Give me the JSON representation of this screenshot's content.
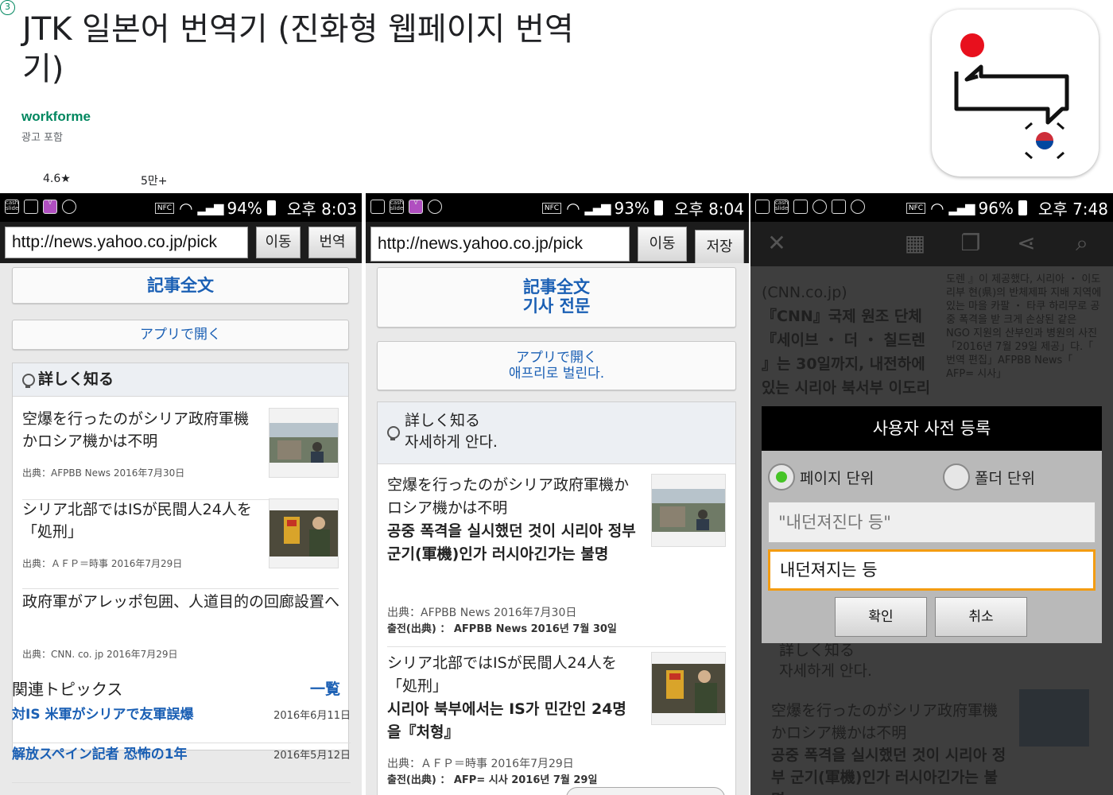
{
  "header": {
    "title": "JTK 일본어 번역기 (진화형 웹페이지 번역기)",
    "developer": "workforme",
    "ads": "광고 포함",
    "rating": "4.6★",
    "downloads": "5만+",
    "age": "3"
  },
  "colors": {
    "link_blue": "#1a5fb4",
    "developer_green": "#01875f",
    "accent_orange": "#f39c12",
    "radio_green": "#46c427"
  },
  "panel1": {
    "status": {
      "icons": [
        "cash-slide-icon",
        "image-icon",
        "v-icon",
        "location-icon"
      ],
      "nfc": "NFC",
      "battery": "94%",
      "time": "오후 8:03"
    },
    "url": "http://news.yahoo.co.jp/pick",
    "go_label": "이동",
    "translate_label": "번역",
    "full_article": "記事全文",
    "open_app": "アプリで開く",
    "learn_more": "詳しく知る",
    "news": [
      {
        "title": "空爆を行ったのがシリア政府軍機かロシア機かは不明",
        "source": "出典：AFPBB News 2016年7月30日"
      },
      {
        "title": "シリア北部ではISが民間人24人を「処刑」",
        "source": "出典：ＡＦＰ＝時事 2016年7月29日"
      },
      {
        "title": "政府軍がアレッポ包囲、人道目的の回廊設置へ",
        "source": "出典：CNN. co. jp 2016年7月29日"
      }
    ],
    "topics_title": "関連トピックス",
    "topics_more": "一覧",
    "topics": [
      {
        "label": "対IS 米軍がシリアで友軍誤爆",
        "date": "2016年6月11日"
      },
      {
        "label": "解放スペイン記者 恐怖の1年",
        "date": "2016年5月12日"
      }
    ]
  },
  "panel2": {
    "status": {
      "nfc": "NFC",
      "battery": "93%",
      "time": "오후 8:04"
    },
    "url": "http://news.yahoo.co.jp/pick",
    "go_label": "이동",
    "save_label": "저장",
    "full_article": "記事全文",
    "full_article_ko": "기사 전문",
    "open_app": "アプリで開く",
    "open_app_ko": "애프리로 벌린다.",
    "learn_more": "詳しく知る",
    "learn_more_ko": "자세하게 안다.",
    "news": [
      {
        "title": "空爆を行ったのがシリア政府軍機かロシア機かは不明",
        "title_ko": "공중 폭격을 실시했던 것이 시리아 정부 군기(軍機)인가 러시아긴가는 불명",
        "source": "出典：AFPBB News 2016年7月30日",
        "source_ko": "출전(出典) ： AFPBB News 2016년 7월 30일"
      },
      {
        "title": "シリア北部ではISが民間人24人を「処刑」",
        "title_ko": "시리아 북부에서는 IS가 민간인 24명을『처형』",
        "source": "出典：ＡＦＰ＝時事 2016年7月29日",
        "source_ko": "출전(出典) ： AFP= 시사 2016년 7월 29일"
      }
    ]
  },
  "panel3": {
    "status": {
      "nfc": "NFC",
      "battery": "96%",
      "time": "오후 7:48"
    },
    "bg": {
      "line1": "(CNN.co.jp)",
      "line2": "『CNN』국제 원조 단체",
      "line3": "『세이브 ・ 더 ・ 칠드렌",
      "line4": "』는 30일까지, 내전하에",
      "line5": "있는 시리아 북서부 이도리",
      "side": "도렌 』이 제공했다, 시리아 ・ 이도리부 현(県)의 반체제파 지배 지역에 있는 마을 카팔 ・ 타쿠 하리무로 공중 폭격을 받 크게 손상된 같은 NGO 지원의 산부인과 병원의 사진「2016년 7월 29일 제공」다.「 번역 편집」AFPBB News「 AFP= 시사」",
      "learn_more": "詳しく知る",
      "learn_more_ko": "자세하게 안다.",
      "news_title": "空爆を行ったのがシリア政府軍機かロシア機かは不明",
      "news_title_ko": "공중 폭격을 실시했던 것이 시리아 정부 군기(軍機)인가 러시아긴가는 불명"
    },
    "dialog": {
      "title": "사용자 사전 등록",
      "radio_page": "페이지 단위",
      "radio_folder": "폴더 단위",
      "original": "\"내던져진다 등\"",
      "input_value": "내던져지는 등",
      "ok": "확인",
      "cancel": "취소"
    }
  }
}
